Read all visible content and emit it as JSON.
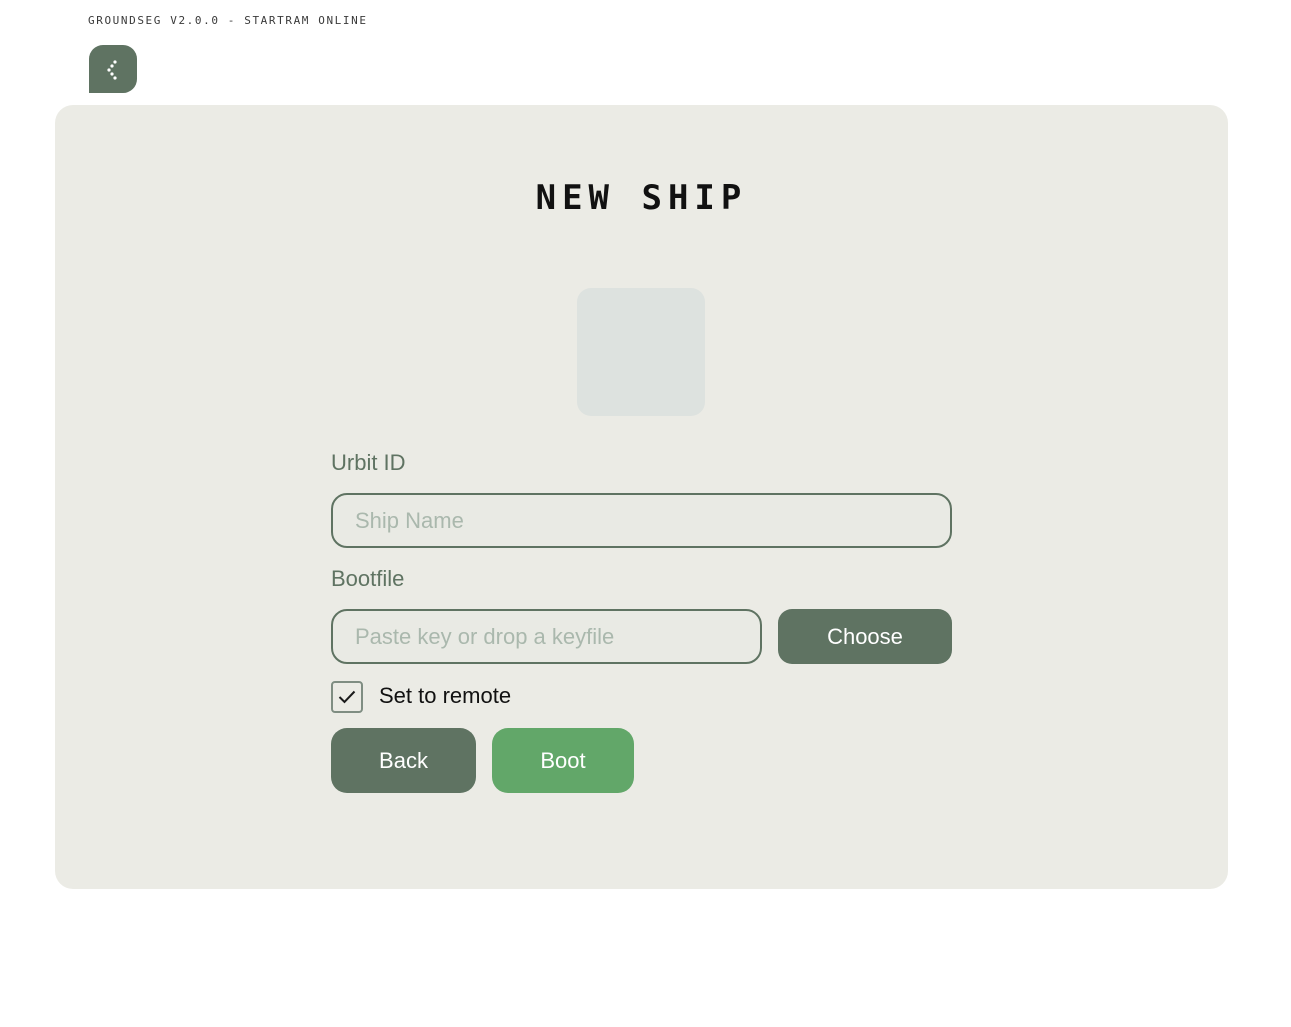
{
  "header": {
    "status_text": "GROUNDSEG V2.0.0 - STARTRAM ONLINE",
    "menu_icon": "share-dots-icon"
  },
  "form": {
    "title": "NEW SHIP",
    "urbit_id_label": "Urbit ID",
    "ship_name_placeholder": "Ship Name",
    "ship_name_value": "",
    "bootfile_label": "Bootfile",
    "bootfile_placeholder": "Paste key or drop a keyfile",
    "bootfile_value": "",
    "choose_label": "Choose",
    "remote_label": "Set to remote",
    "remote_checked": true,
    "back_label": "Back",
    "boot_label": "Boot"
  },
  "colors": {
    "primary": "#5f7362",
    "accent": "#62a769",
    "panel_bg": "#ebebe5",
    "sigil_bg": "#dde2df"
  }
}
